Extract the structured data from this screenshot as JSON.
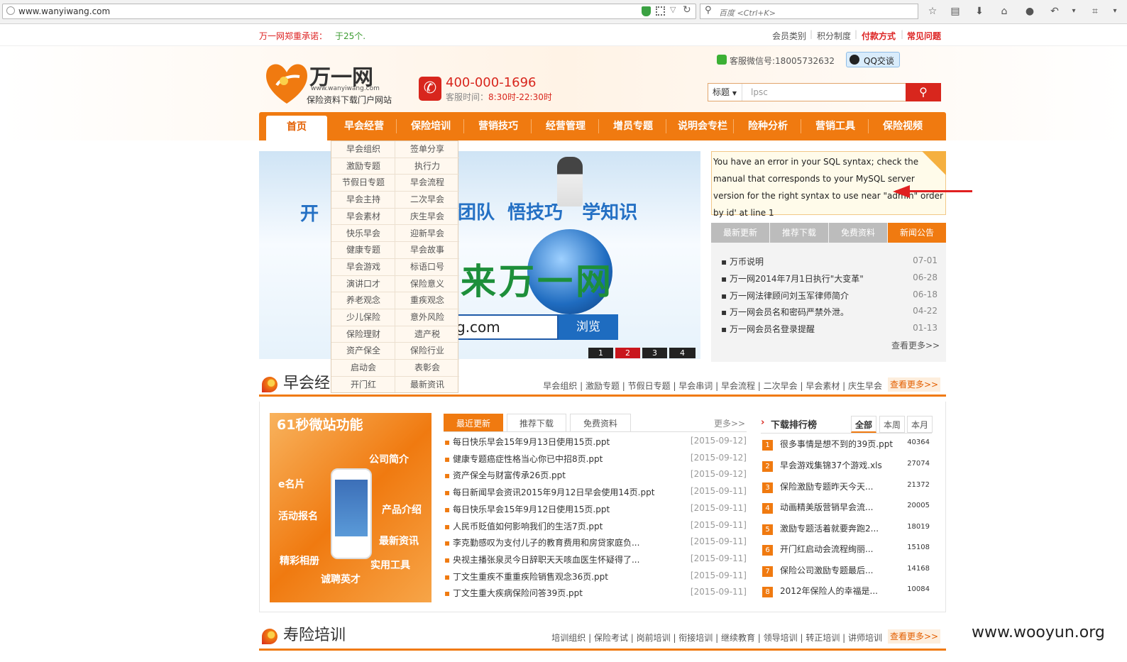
{
  "browser": {
    "url": "www.wanyiwang.com",
    "search_placeholder": "百度 <Ctrl+K>"
  },
  "topstrip": {
    "promise_label": "万一网郑重承诺：",
    "promise_value": "于25个.",
    "links": [
      "会员类别",
      "积分制度",
      "付款方式",
      "常见问题"
    ]
  },
  "header": {
    "logo_title": "万一网",
    "logo_url": "www.wanyiwang.com",
    "logo_subtitle": "保险资料下载门户网站",
    "phone": "400-000-1696",
    "service_hours_label": "客服时间：",
    "service_hours": "8:30时-22:30时",
    "wechat": "客服微信号:18005732632",
    "qq_label": "QQ交谈",
    "search_type": "标题",
    "search_value": "lpsc"
  },
  "nav": {
    "items": [
      "首页",
      "早会经营",
      "保险培训",
      "营销技巧",
      "经营管理",
      "增员专题",
      "说明会专栏",
      "险种分析",
      "营销工具",
      "保险视频"
    ]
  },
  "dropdown": {
    "left": [
      "早会组织",
      "激励专题",
      "节假日专题",
      "早会主持",
      "早会素材",
      "快乐早会",
      "健康专题",
      "早会游戏",
      "演讲口才",
      "养老观念",
      "少儿保险",
      "保险理财",
      "资产保全",
      "启动会",
      "开门红"
    ],
    "right": [
      "签单分享",
      "执行力",
      "早会流程",
      "二次早会",
      "庆生早会",
      "迎新早会",
      "早会故事",
      "标语口号",
      "保险意义",
      "重疾观念",
      "意外风险",
      "遗产税",
      "保险行业",
      "表彰会",
      "最新资讯"
    ]
  },
  "banner": {
    "slogan_left": "开",
    "slogan_mid": "团队  悟技巧   学知识",
    "welcome": "来万一网",
    "url_fragment": "g.com",
    "browse_button": "浏览",
    "pages": [
      "1",
      "2",
      "3",
      "4"
    ]
  },
  "error_box": {
    "text": "You have an error in your SQL syntax; check the manual that corresponds to your MySQL server version for the right syntax to use near \"admin\" order by id' at line 1"
  },
  "news": {
    "tabs": [
      "最新更新",
      "推荐下载",
      "免费资料",
      "新闻公告"
    ],
    "items": [
      {
        "title": "万币说明",
        "date": "07-01"
      },
      {
        "title": "万一网2014年7月1日执行\"大变革\"",
        "date": "06-28"
      },
      {
        "title": "万一网法律顾问刘玉军律师简介",
        "date": "06-18"
      },
      {
        "title": "万一网会员名和密码严禁外泄。",
        "date": "04-22"
      },
      {
        "title": "万一网会员名登录提醒",
        "date": "01-13"
      }
    ],
    "more": "查看更多>>"
  },
  "section1": {
    "title": "早会经",
    "links": "早会组织 | 激励专题 | 节假日专题 | 早会串词 | 早会流程 | 二次早会 | 早会素材 | 庆生早会",
    "more": "查看更多>>"
  },
  "promo": {
    "title": "61秒微站功能",
    "labels": [
      "公司简介",
      "e名片",
      "产品介绍",
      "活动报名",
      "最新资讯",
      "精彩相册",
      "实用工具",
      "诚聘英才"
    ]
  },
  "list": {
    "tabs": [
      "最近更新",
      "推荐下载",
      "免费资料"
    ],
    "more": "更多>>",
    "items": [
      {
        "title": "每日快乐早会15年9月13日使用15页.ppt",
        "date": "[2015-09-12]"
      },
      {
        "title": "健康专题癌症性格当心你已中招8页.ppt",
        "date": "[2015-09-12]"
      },
      {
        "title": "资产保全与财富传承26页.ppt",
        "date": "[2015-09-12]"
      },
      {
        "title": "每日新闻早会资讯2015年9月12日早会使用14页.ppt",
        "date": "[2015-09-11]"
      },
      {
        "title": "每日快乐早会15年9月12日使用15页.ppt",
        "date": "[2015-09-11]"
      },
      {
        "title": "人民币贬值如何影响我们的生活7页.ppt",
        "date": "[2015-09-11]"
      },
      {
        "title": "李克勤感叹为支付儿子的教育费用和房贷家庭负...",
        "date": "[2015-09-11]"
      },
      {
        "title": "央视主播张泉灵今日辞职天天咳血医生怀疑得了...",
        "date": "[2015-09-11]"
      },
      {
        "title": "丁文生重疾不重重疾险销售观念36页.ppt",
        "date": "[2015-09-11]"
      },
      {
        "title": "丁文生重大疾病保险问答39页.ppt",
        "date": "[2015-09-11]"
      }
    ]
  },
  "ranking": {
    "title": "下载排行榜",
    "tabs": [
      "全部",
      "本周",
      "本月"
    ],
    "items": [
      {
        "n": "1",
        "title": "很多事情是想不到的39页.ppt",
        "count": "40364"
      },
      {
        "n": "2",
        "title": "早会游戏集锦37个游戏.xls",
        "count": "27074"
      },
      {
        "n": "3",
        "title": "保险激励专题昨天今天...",
        "count": "21372"
      },
      {
        "n": "4",
        "title": "动画精美版营销早会流...",
        "count": "20005"
      },
      {
        "n": "5",
        "title": "激励专题活着就要奔跑2...",
        "count": "18019"
      },
      {
        "n": "6",
        "title": "开门红启动会流程绚丽...",
        "count": "15108"
      },
      {
        "n": "7",
        "title": "保险公司激励专题最后...",
        "count": "14168"
      },
      {
        "n": "8",
        "title": "2012年保险人的幸福是...",
        "count": "10084"
      }
    ]
  },
  "section2": {
    "title": "寿险培训",
    "links": "培训组织 | 保险考试 | 岗前培训 | 衔接培训 | 继续教育 | 领导培训 | 转正培训 | 讲师培训",
    "more": "查看更多>>"
  },
  "watermark": "www.wooyun.org"
}
